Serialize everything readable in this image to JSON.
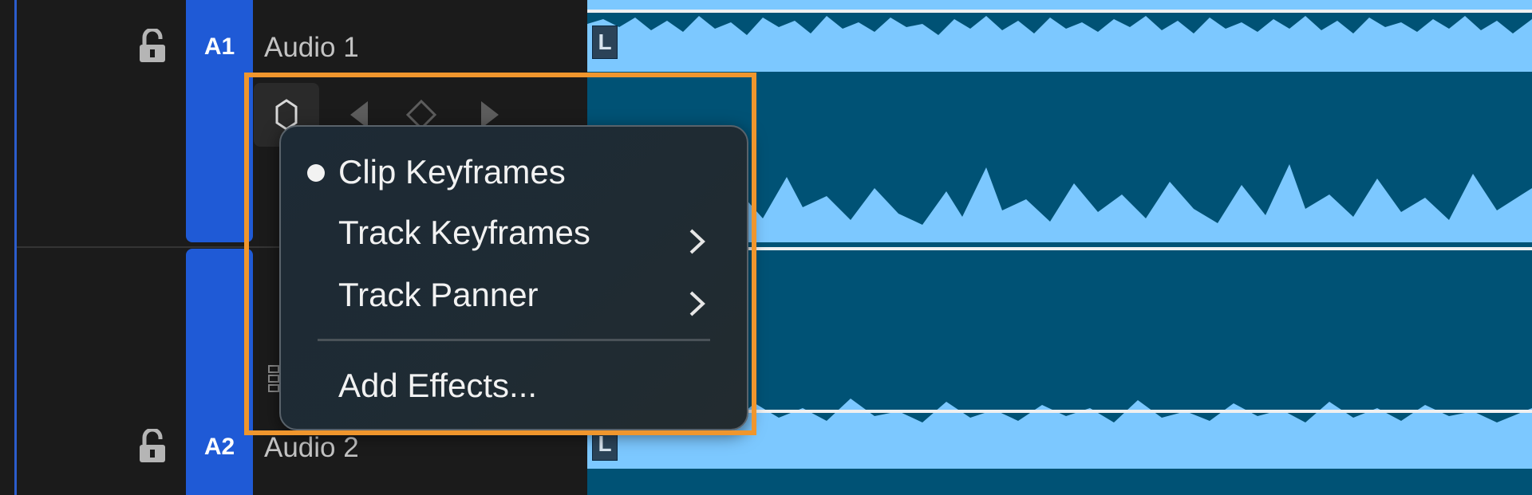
{
  "tracks": [
    {
      "id": "A1",
      "name": "Audio 1"
    },
    {
      "id": "A2",
      "name": "Audio 2"
    }
  ],
  "channel_badge": "L",
  "keyframe_controls": {
    "toggle_icon": "hexagon-keyframe-icon",
    "prev_icon": "triangle-left-icon",
    "add_icon": "diamond-icon",
    "next_icon": "triangle-right-icon"
  },
  "context_menu": {
    "items": [
      {
        "label": "Clip Keyframes",
        "checked": true,
        "has_submenu": false
      },
      {
        "label": "Track Keyframes",
        "checked": false,
        "has_submenu": true
      },
      {
        "label": "Track Panner",
        "checked": false,
        "has_submenu": true
      },
      {
        "label": "Add Effects...",
        "checked": false,
        "has_submenu": false
      }
    ]
  },
  "colors": {
    "track_tab": "#1f5ad6",
    "timeline_bg": "#005275",
    "waveform": "#7cc8ff",
    "highlight": "#f0962d"
  }
}
